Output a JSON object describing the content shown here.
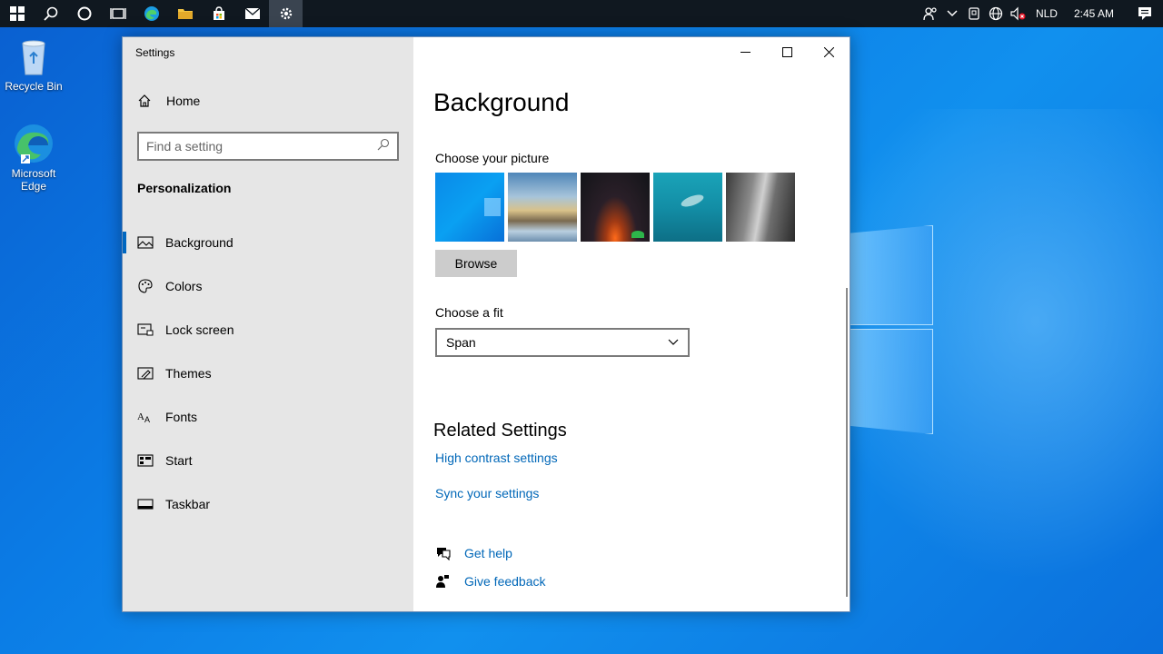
{
  "taskbar": {
    "language": "NLD",
    "clock": "2:45 AM"
  },
  "desktop": {
    "icons": [
      {
        "label": "Recycle Bin"
      },
      {
        "label": "Microsoft Edge"
      }
    ]
  },
  "window": {
    "title": "Settings"
  },
  "sidebar": {
    "home_label": "Home",
    "search_placeholder": "Find a setting",
    "section_title": "Personalization",
    "items": [
      {
        "label": "Background",
        "icon": "picture-icon"
      },
      {
        "label": "Colors",
        "icon": "palette-icon"
      },
      {
        "label": "Lock screen",
        "icon": "lock-screen-icon"
      },
      {
        "label": "Themes",
        "icon": "themes-icon"
      },
      {
        "label": "Fonts",
        "icon": "fonts-icon"
      },
      {
        "label": "Start",
        "icon": "start-icon"
      },
      {
        "label": "Taskbar",
        "icon": "taskbar-icon"
      }
    ]
  },
  "content": {
    "title": "Background",
    "choose_picture_label": "Choose your picture",
    "browse_label": "Browse",
    "choose_fit_label": "Choose a fit",
    "fit_value": "Span",
    "related_title": "Related Settings",
    "related_links": [
      "High contrast settings",
      "Sync your settings"
    ],
    "help_label": "Get help",
    "feedback_label": "Give feedback"
  },
  "colors": {
    "accent": "#0067c0",
    "link": "#0067b8",
    "sidebar_bg": "#e6e6e6"
  }
}
